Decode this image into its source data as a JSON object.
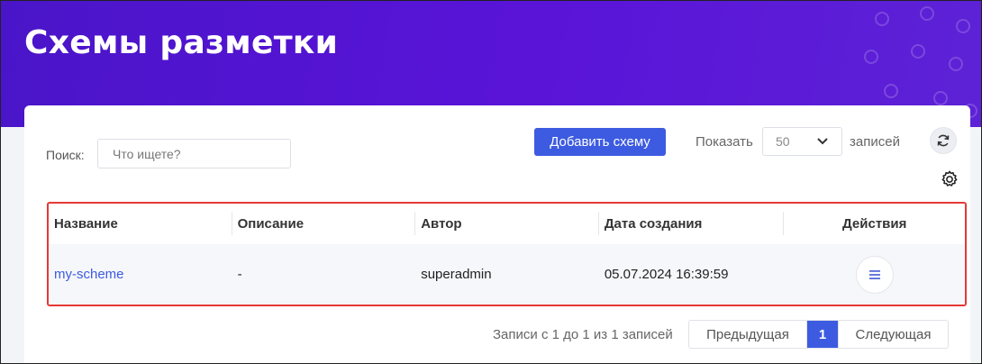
{
  "header": {
    "title": "Схемы разметки"
  },
  "toolbar": {
    "search_label": "Поиск:",
    "search_placeholder": "Что ищете?",
    "search_value": "",
    "add_button_label": "Добавить схему",
    "show_label": "Показать",
    "page_size_value": "50",
    "records_label": "записей",
    "refresh_icon": "refresh-icon",
    "settings_icon": "gear-icon"
  },
  "table": {
    "columns": [
      "Название",
      "Описание",
      "Автор",
      "Дата создания",
      "Действия"
    ],
    "rows": [
      {
        "name": "my-scheme",
        "description": "-",
        "author": "superadmin",
        "created": "05.07.2024 16:39:59",
        "actions_icon": "menu-icon"
      }
    ]
  },
  "footer": {
    "info": "Записи с 1 до 1 из 1 записей",
    "prev_label": "Предыдущая",
    "current_page": "1",
    "next_label": "Следующая"
  },
  "colors": {
    "banner": "#4a15c9",
    "accent": "#3d5be0",
    "highlight_border": "#e53935"
  }
}
